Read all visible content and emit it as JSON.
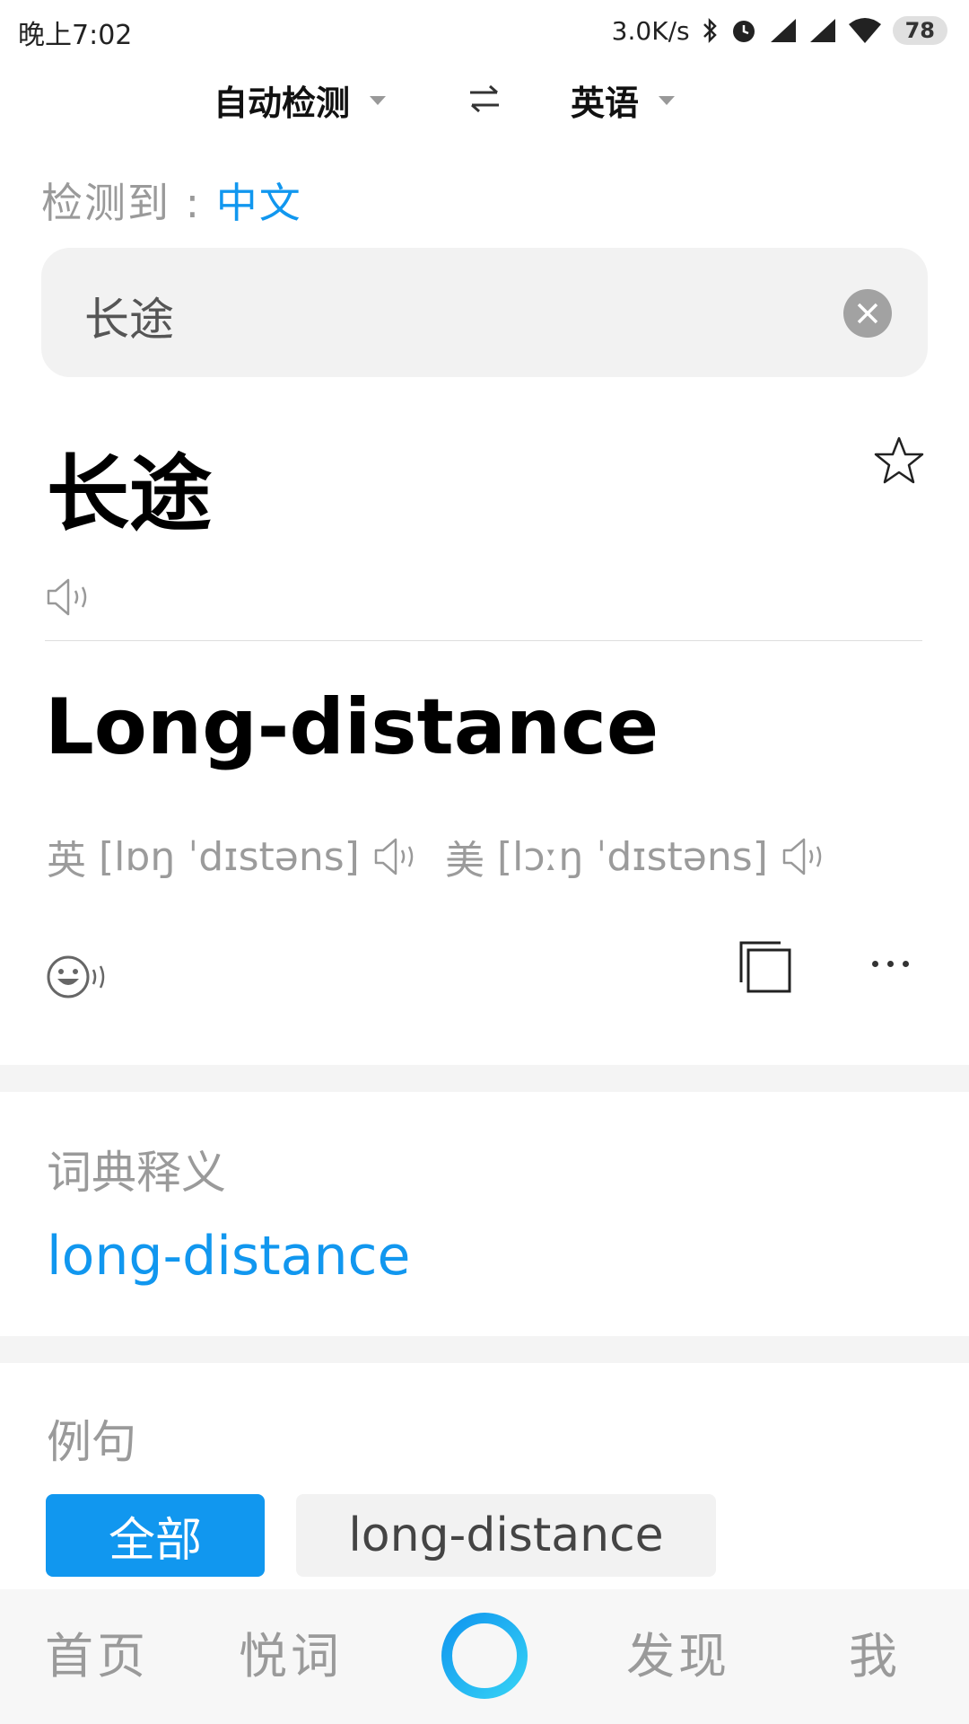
{
  "status_bar": {
    "time": "晚上7:02",
    "network_speed": "3.0K/s",
    "battery": "78",
    "icons": [
      "bluetooth-icon",
      "alarm-icon",
      "signal-icon",
      "signal-icon",
      "wifi-icon",
      "battery-icon"
    ]
  },
  "language_bar": {
    "source": "自动检测",
    "target": "英语",
    "swap_icon": "swap-icon"
  },
  "detected": {
    "label": "检测到 :",
    "language": "中文"
  },
  "input": {
    "value": "长途",
    "clear_icon": "clear-icon"
  },
  "result": {
    "source_word": "长途",
    "translation": "Long-distance",
    "uk_label": "英",
    "uk_phonetic": "[lɒŋ ˈdɪstəns]",
    "us_label": "美",
    "us_phonetic": "[lɔːŋ ˈdɪstəns]"
  },
  "dictionary": {
    "title": "词典释义",
    "entry": "long-distance"
  },
  "examples": {
    "title": "例句",
    "filters": [
      "全部",
      "long-distance"
    ]
  },
  "bottom_nav": {
    "items": [
      "首页",
      "悦词",
      "发现",
      "我"
    ]
  },
  "colors": {
    "accent": "#1197ef",
    "muted_text": "#9a9a9a",
    "input_bg": "#f2f2f2"
  }
}
